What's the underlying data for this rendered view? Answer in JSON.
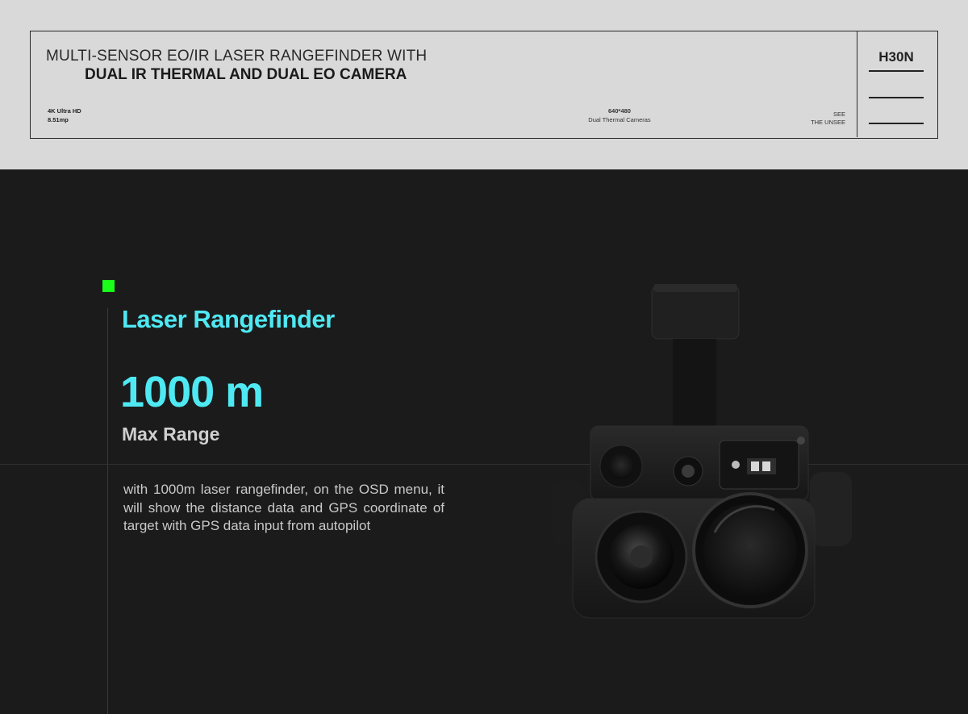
{
  "banner": {
    "headline_line1": "MULTI-SENSOR EO/IR LASER RANGEFINDER WITH",
    "headline_line2": "DUAL IR THERMAL AND DUAL EO CAMERA",
    "spec_eo": {
      "line1": "4K Ultra HD",
      "line2": "8.51mp"
    },
    "spec_ir": {
      "line1": "640*480",
      "line2": "Dual Thermal Cameras"
    },
    "tagline": {
      "line1": "SEE",
      "line2": "THE UNSEE"
    },
    "model": "H30N"
  },
  "feature": {
    "title": "Laser Rangefinder",
    "value": "1000 m",
    "value_label": "Max Range",
    "description": "with 1000m laser rangefinder, on the OSD menu, it will show the distance data and GPS coordinate of target with GPS data input from autopilot"
  },
  "colors": {
    "accent_cyan": "#4ee9f3",
    "accent_green": "#19ff19",
    "banner_bg": "#d9d9d9",
    "panel_bg": "#1b1b1b"
  },
  "icons": [
    "accent-square-icon",
    "gimbal-camera-image"
  ]
}
